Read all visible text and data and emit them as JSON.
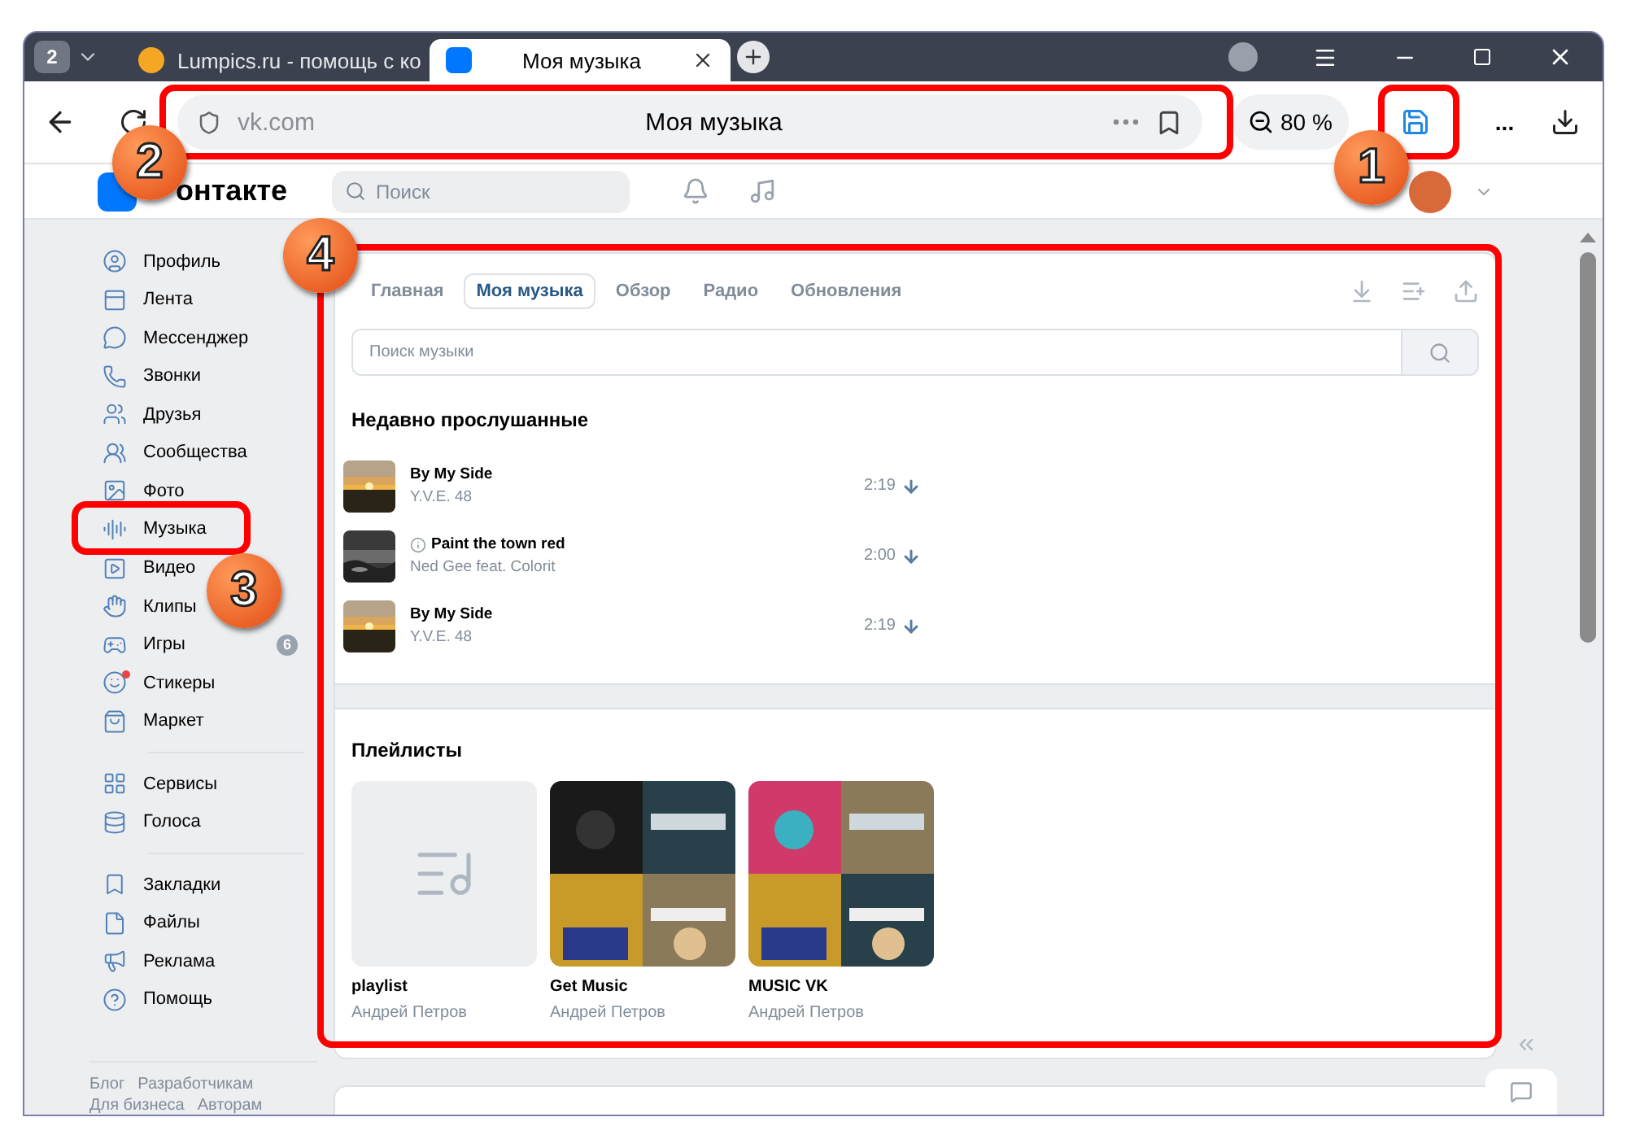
{
  "browser": {
    "tab_count": "2",
    "tabs": [
      {
        "title": "Lumpics.ru - помощь с ко",
        "selected": false,
        "kind": "site"
      },
      {
        "title": "Моя музыка",
        "selected": true,
        "kind": "vk"
      }
    ],
    "address": {
      "domain": "vk.com",
      "title": "Моя музыка"
    },
    "zoom": "80 %",
    "more": "..."
  },
  "header": {
    "logo_text": "онтакте",
    "search_placeholder": "Поиск"
  },
  "sidebar": {
    "groups": [
      [
        {
          "label": "Профиль"
        },
        {
          "label": "Лента"
        },
        {
          "label": "Мессенджер"
        },
        {
          "label": "Звонки"
        },
        {
          "label": "Друзья"
        },
        {
          "label": "Сообщества"
        },
        {
          "label": "Фото"
        },
        {
          "label": "Музыка"
        },
        {
          "label": "Видео"
        },
        {
          "label": "Клипы"
        },
        {
          "label": "Игры",
          "badge": "6"
        },
        {
          "label": "Стикеры",
          "dot": true
        },
        {
          "label": "Маркет"
        }
      ],
      [
        {
          "label": "Сервисы"
        },
        {
          "label": "Голоса"
        }
      ],
      [
        {
          "label": "Закладки"
        },
        {
          "label": "Файлы"
        },
        {
          "label": "Реклама"
        },
        {
          "label": "Помощь"
        }
      ]
    ],
    "footer_links": [
      "Блог",
      "Разработчикам",
      "Для бизнеса",
      "Авторам"
    ]
  },
  "music": {
    "tabs": [
      {
        "label": "Главная",
        "selected": false
      },
      {
        "label": "Моя музыка",
        "selected": true
      },
      {
        "label": "Обзор",
        "selected": false
      },
      {
        "label": "Радио",
        "selected": false
      },
      {
        "label": "Обновления",
        "selected": false
      }
    ],
    "search_placeholder": "Поиск музыки",
    "recent_title": "Недавно прослушанные",
    "tracks": [
      {
        "title": "By My Side",
        "artist": "Y.V.E. 48",
        "duration": "2:19",
        "notice": false
      },
      {
        "title": "Paint the town red",
        "artist": "Ned Gee feat. Colorit",
        "duration": "2:00",
        "notice": true
      },
      {
        "title": "By My Side",
        "artist": "Y.V.E. 48",
        "duration": "2:19",
        "notice": false
      }
    ],
    "playlists_title": "Плейлисты",
    "playlists": [
      {
        "name": "playlist",
        "author": "Андрей Петров",
        "kind": "empty"
      },
      {
        "name": "Get Music",
        "author": "Андрей Петров",
        "kind": "picture"
      },
      {
        "name": "MUSIC VK",
        "author": "Андрей Петров",
        "kind": "picture"
      }
    ]
  },
  "annotations": [
    "1",
    "2",
    "3",
    "4"
  ]
}
